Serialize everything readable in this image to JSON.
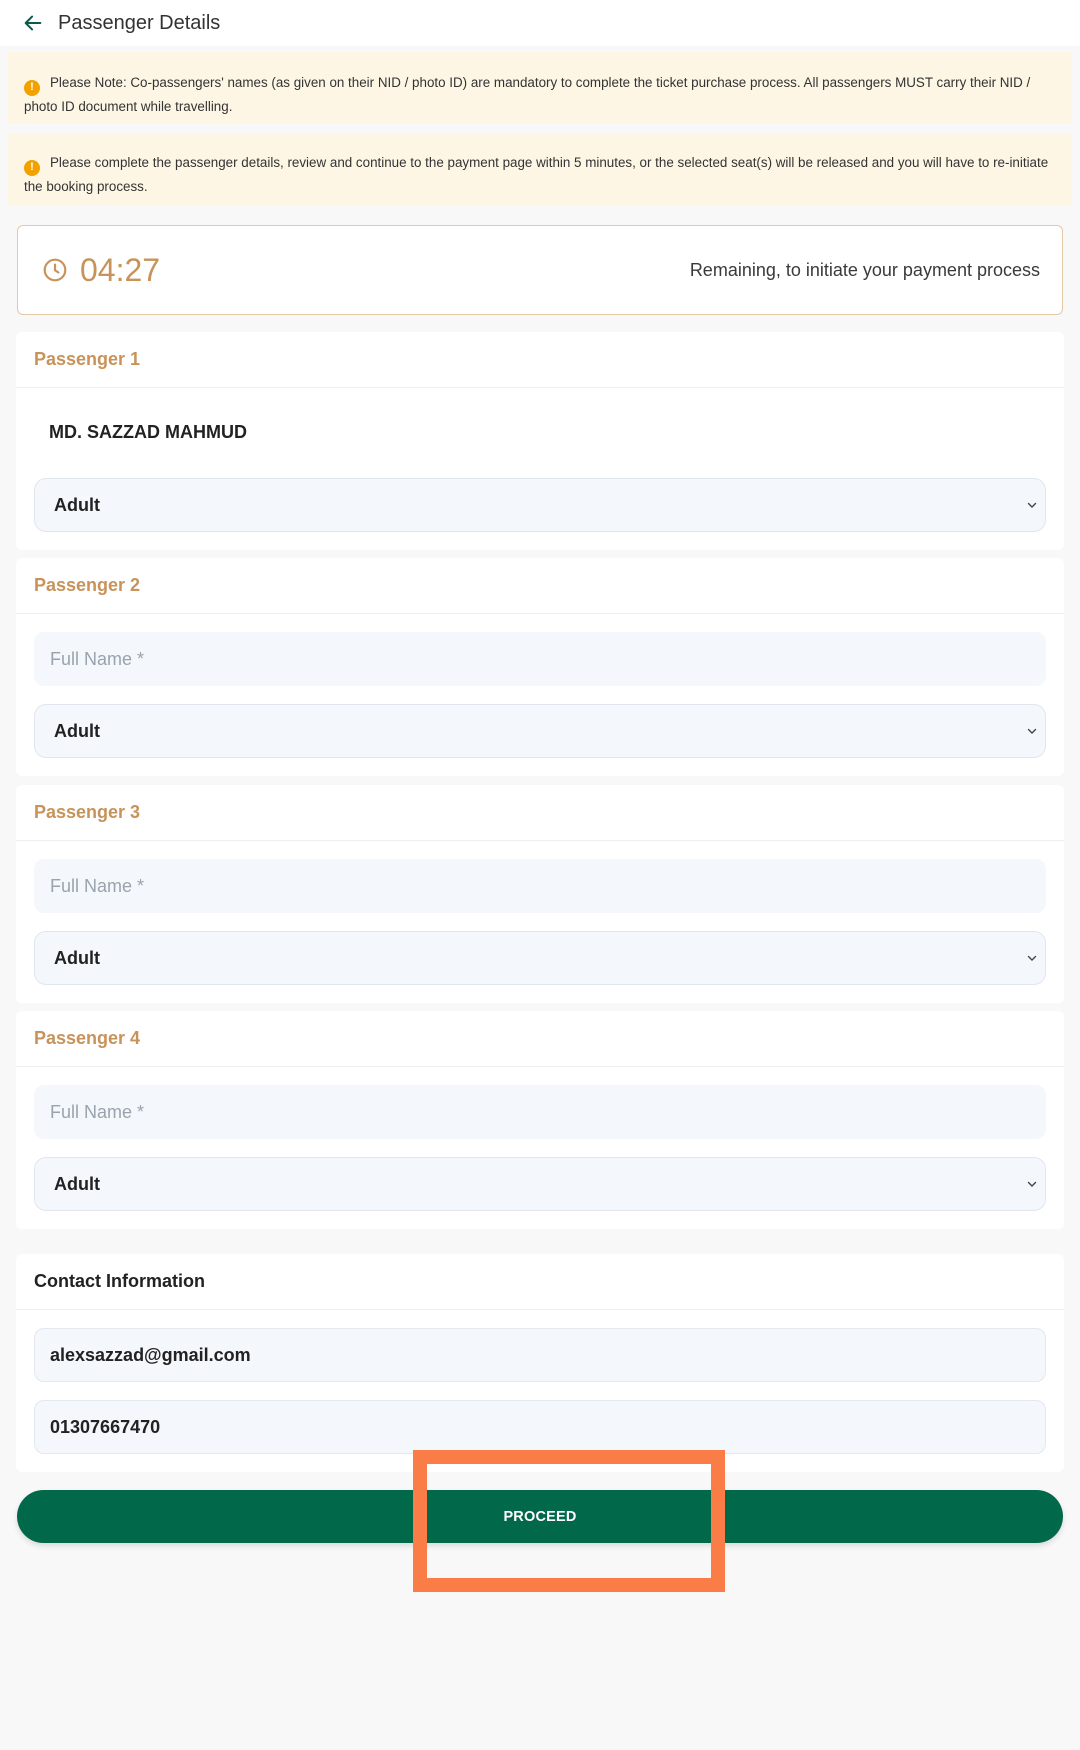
{
  "header": {
    "title": "Passenger Details"
  },
  "notices": [
    "Please Note: Co-passengers' names (as given on their NID / photo ID) are mandatory to complete the ticket purchase process. All passengers MUST carry their NID / photo ID document while travelling.",
    "Please complete the passenger details, review and continue to the payment page within 5 minutes, or the selected seat(s) will be released and you will have to re-initiate the booking process."
  ],
  "timer": {
    "value": "04:27",
    "text": "Remaining, to initiate your payment process"
  },
  "passengers": [
    {
      "title": "Passenger 1",
      "name": "MD. SAZZAD MAHMUD",
      "type": "Adult"
    },
    {
      "title": "Passenger 2",
      "name_placeholder": "Full Name *",
      "type": "Adult"
    },
    {
      "title": "Passenger 3",
      "name_placeholder": "Full Name *",
      "type": "Adult"
    },
    {
      "title": "Passenger 4",
      "name_placeholder": "Full Name *",
      "type": "Adult"
    }
  ],
  "contact": {
    "title": "Contact Information",
    "email": "alexsazzad@gmail.com",
    "phone": "01307667470"
  },
  "proceed_label": "PROCEED",
  "colors": {
    "accent": "#c8935a",
    "primary_button": "#02684a",
    "notice_bg": "#fdf6e5",
    "highlight": "#fa7c47"
  }
}
